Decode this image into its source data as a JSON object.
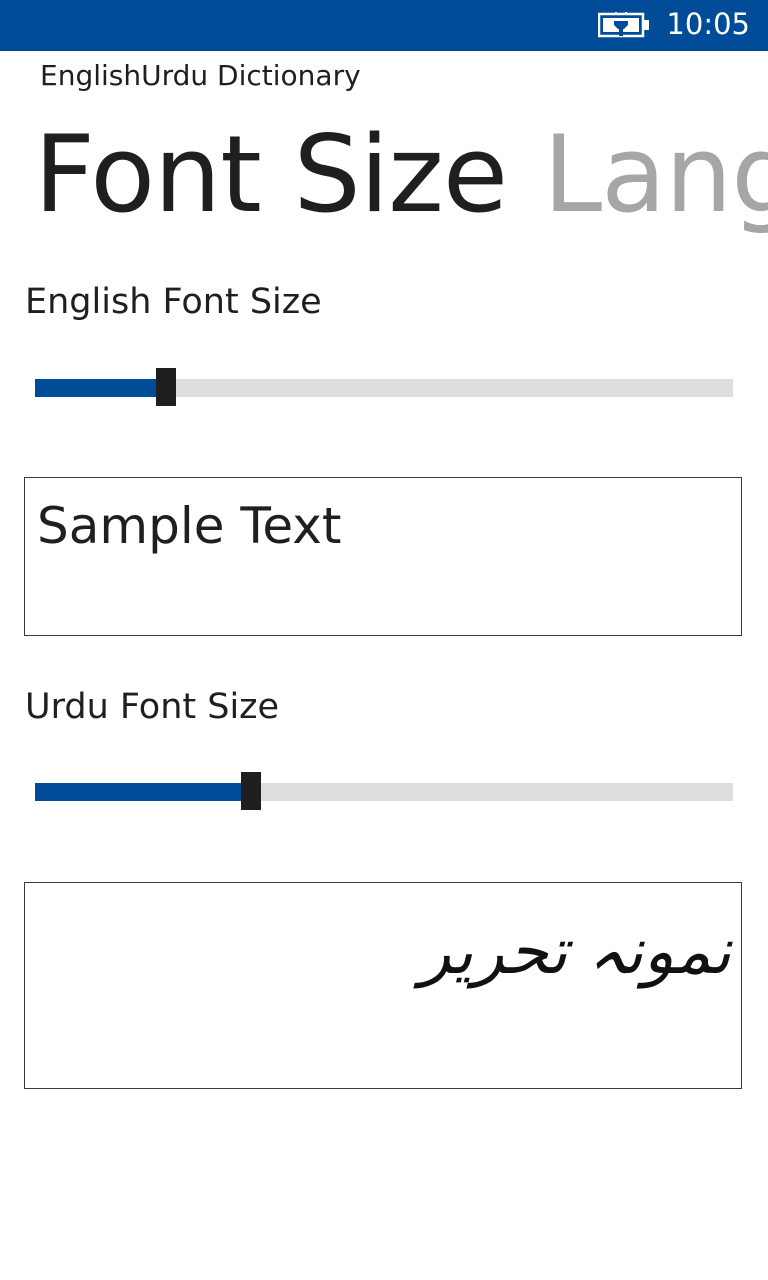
{
  "status_bar": {
    "time": "10:05",
    "battery_icon": "battery-charging-icon",
    "background": "#004c99"
  },
  "app": {
    "title": "EnglishUrdu Dictionary"
  },
  "pivot": {
    "items": [
      {
        "label": "Font Size",
        "active": true
      },
      {
        "label": "Language",
        "active": false
      }
    ]
  },
  "english_font": {
    "label": "English Font Size",
    "slider_value": 0.187,
    "sample_text": "Sample Text"
  },
  "urdu_font": {
    "label": "Urdu Font Size",
    "slider_value": 0.31,
    "sample_text": "نمونہ تحریر"
  },
  "colors": {
    "accent": "#004c99",
    "track": "#dedede",
    "thumb": "#1f1f1f",
    "text": "#1f1f1f",
    "inactive_pivot": "#a6a6a6"
  }
}
